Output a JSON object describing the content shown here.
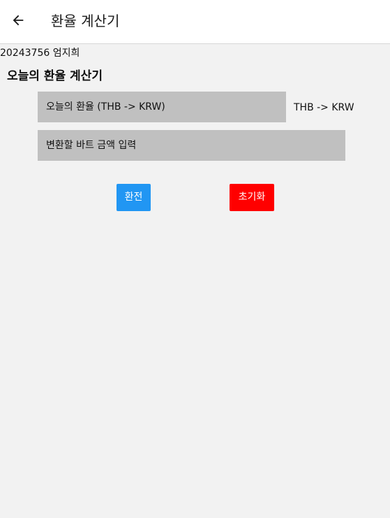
{
  "app_bar": {
    "back_icon": "arrow-left-icon",
    "title": "환율 계산기"
  },
  "main": {
    "student_info": "20243756 엄지희",
    "heading": "오늘의 환율 계산기",
    "rate_input": {
      "placeholder": "오늘의 환율 (THB -> KRW)",
      "value": ""
    },
    "rate_unit_label": "THB -> KRW",
    "amount_input": {
      "placeholder": "변환할 바트 금액 입력",
      "value": ""
    },
    "convert_button": {
      "label": "환전",
      "color": "#2196f3"
    },
    "reset_button": {
      "label": "초기화",
      "color": "#ff0000"
    }
  }
}
